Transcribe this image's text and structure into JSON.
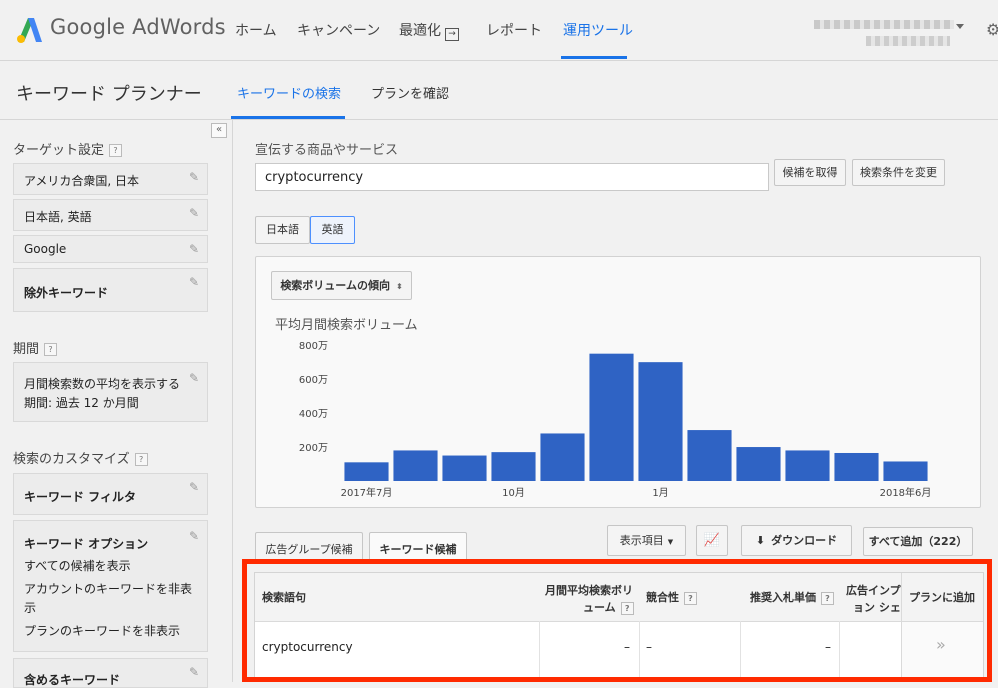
{
  "app": {
    "logo_text": "Google AdWords"
  },
  "nav": {
    "items": [
      "ホーム",
      "キャンペーン",
      "最適化",
      "レポート",
      "運用ツール"
    ],
    "active": "運用ツール"
  },
  "planner": {
    "title": "キーワード プランナー",
    "tabs": [
      "キーワードの検索",
      "プランを確認"
    ]
  },
  "sidebar": {
    "collapse": "«",
    "qmark": "?",
    "target_heading": "ターゲット設定",
    "target_items": [
      "アメリカ合衆国, 日本",
      "日本語, 英語",
      "Google",
      "除外キーワード"
    ],
    "period_heading": "期間",
    "period_text_1": "月間検索数の平均を表示する",
    "period_text_2": "期間: 過去 12 か月間",
    "custom_heading": "検索のカスタマイズ",
    "kw_filter": "キーワード フィルタ",
    "kw_options_title": "キーワード オプション",
    "kw_options": [
      "すべての候補を表示",
      "アカウントのキーワードを非表示",
      "プランのキーワードを非表示"
    ],
    "include_kw": "含めるキーワード"
  },
  "search": {
    "product_label": "宣伝する商品やサービス",
    "keyword_value": "cryptocurrency",
    "get_ideas": "候補を取得",
    "modify_search": "検索条件を変更"
  },
  "lang_tabs": [
    "日本語",
    "英語"
  ],
  "chart": {
    "dropdown": "検索ボリュームの傾向",
    "label": "平均月間検索ボリューム"
  },
  "chart_data": {
    "type": "bar",
    "categories": [
      "2017年7月",
      "2017年8月",
      "2017年9月",
      "10月",
      "2017年11月",
      "2017年12月",
      "1月",
      "2018年2月",
      "2018年3月",
      "2018年4月",
      "2018年5月",
      "2018年6月"
    ],
    "x_tick_labels": [
      "2017年7月",
      "10月",
      "1月",
      "2018年6月"
    ],
    "values": [
      1100000,
      1800000,
      1500000,
      1700000,
      2800000,
      7500000,
      7000000,
      3000000,
      2000000,
      1800000,
      1650000,
      1150000
    ],
    "y_tick_labels": [
      "200万",
      "400万",
      "600万",
      "800万"
    ],
    "y_ticks": [
      2000000,
      4000000,
      6000000,
      8000000
    ],
    "ylim": [
      0,
      8600000
    ],
    "color": "#2f63c4",
    "grid": false
  },
  "controls": {
    "adgroup_tab": "広告グループ候補",
    "keyword_tab": "キーワード候補",
    "columns": "表示項目",
    "download": "ダウンロード",
    "add_all": "すべて追加（222）"
  },
  "table": {
    "headers": {
      "keyword": "検索語句",
      "volume_1": "月間平均検索ボリ",
      "volume_2": "ューム",
      "competition": "競合性",
      "bid": "推奨入札単価",
      "impr_1": "広告インプ",
      "impr_2": "ョン シェ",
      "plan": "プランに追加"
    },
    "row": {
      "keyword": "cryptocurrency",
      "volume": "–",
      "competition": "–",
      "bid": "–",
      "add": "»"
    }
  },
  "colors": {
    "accent": "#1a73e8",
    "bar": "#2f63c4",
    "highlight": "#ff2a00"
  }
}
